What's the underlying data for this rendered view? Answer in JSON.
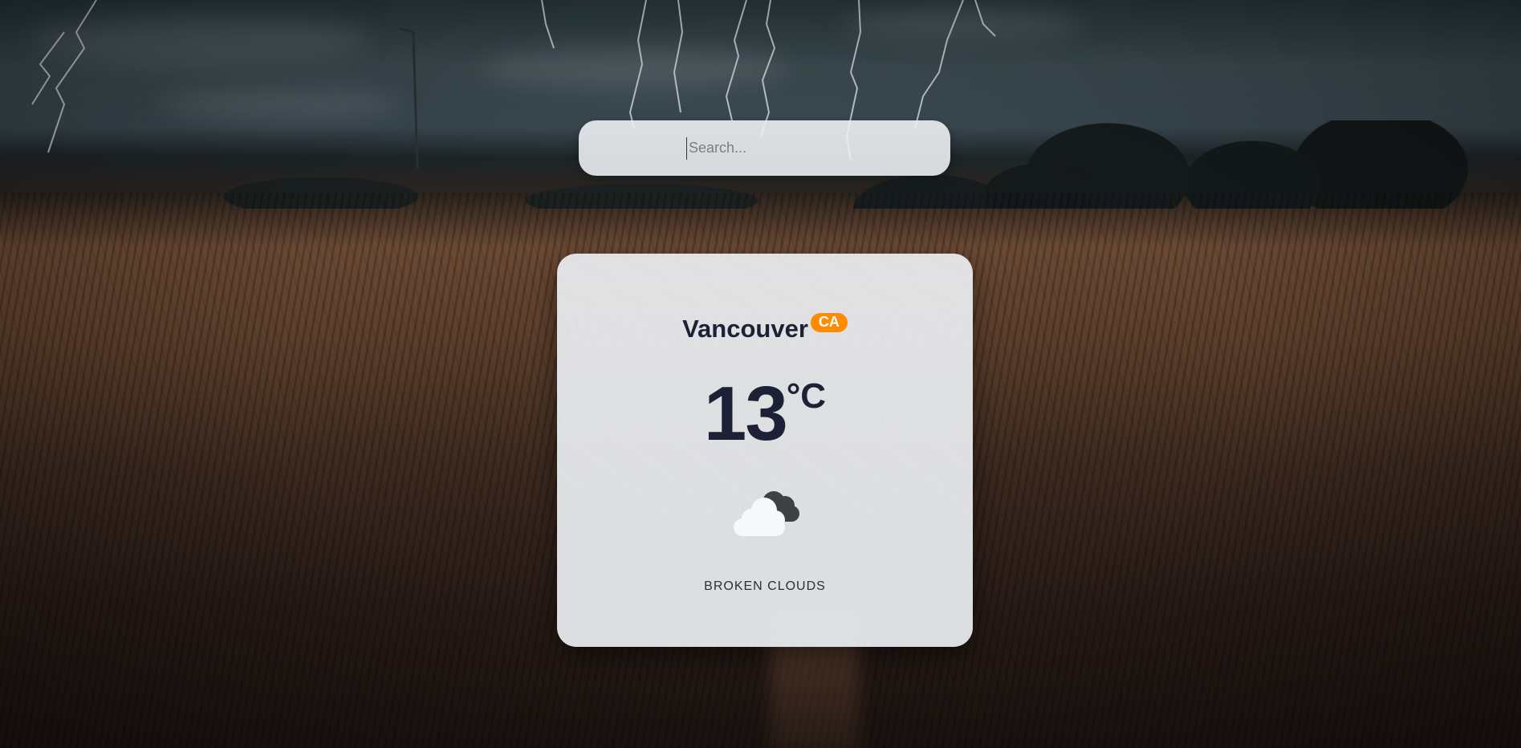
{
  "search": {
    "placeholder": "Search...",
    "value": ""
  },
  "weather": {
    "city": "Vancouver",
    "country_code": "CA",
    "temperature": "13",
    "unit": "°C",
    "icon": "broken-clouds-icon",
    "description": "BROKEN CLOUDS"
  },
  "colors": {
    "country_badge": "#ff8c00",
    "text": "#1d2136",
    "card_bg": "#eceff2"
  }
}
